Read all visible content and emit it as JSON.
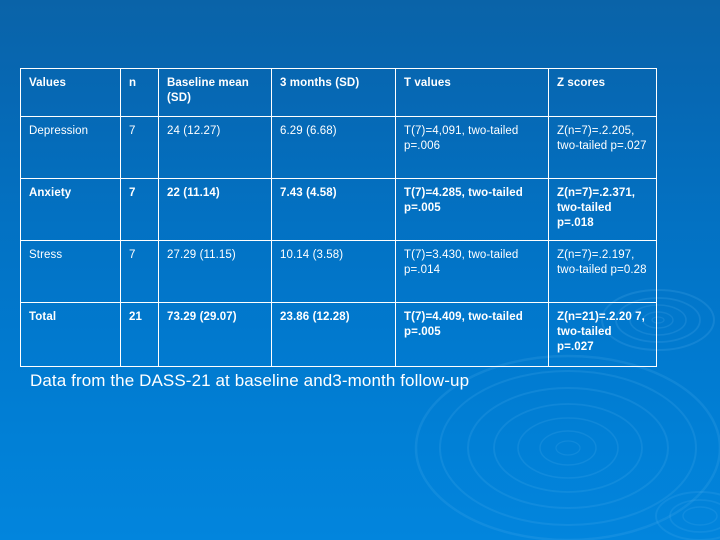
{
  "slide": {
    "caption": "Data from the DASS-21 at baseline and3-month follow-up"
  },
  "colors": {
    "background_top": "#0a63a8",
    "background_bottom": "#0285dd",
    "table_border": "#ffffff",
    "text": "#ffffff"
  },
  "table": {
    "headers": {
      "values": "Values",
      "n": "n",
      "baseline": "Baseline mean (SD)",
      "three_months": "3 months (SD)",
      "t_values": "T values",
      "z_scores": "Z scores"
    },
    "rows": [
      {
        "values": "Depression",
        "n": "7",
        "baseline": "24 (12.27)",
        "three_months": "6.29 (6.68)",
        "t_values": "T(7)=4,091, two-tailed p=.006",
        "z_scores": "Z(n=7)=.2.205, two-tailed p=.027",
        "emphasis": "normal"
      },
      {
        "values": "Anxiety",
        "n": "7",
        "baseline": "22 (11.14)",
        "three_months": "7.43 (4.58)",
        "t_values": "T(7)=4.285, two-tailed p=.005",
        "z_scores": "Z(n=7)=.2.371, two-tailed p=.018",
        "emphasis": "bold"
      },
      {
        "values": "Stress",
        "n": "7",
        "baseline": "27.29 (11.15)",
        "three_months": "10.14 (3.58)",
        "t_values": "T(7)=3.430, two-tailed p=.014",
        "z_scores": "Z(n=7)=.2.197, two-tailed p=0.28",
        "emphasis": "normal"
      },
      {
        "values": "Total",
        "n": "21",
        "baseline": "73.29 (29.07)",
        "three_months": "23.86 (12.28)",
        "t_values": "T(7)=4.409, two-tailed p=.005",
        "z_scores": "Z(n=21)=.2.20 7, two-tailed p=.027",
        "emphasis": "bold"
      }
    ]
  }
}
